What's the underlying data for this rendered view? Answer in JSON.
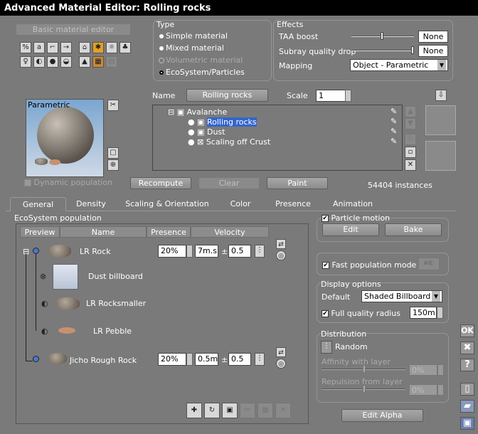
{
  "window": {
    "title": "Advanced Material Editor: Rolling rocks"
  },
  "top": {
    "basic_button": "Basic material editor",
    "type_label": "Type",
    "type_options": [
      "Simple material",
      "Mixed material",
      "Volumetric material",
      "EcoSystem/Particles"
    ],
    "effects_label": "Effects",
    "taa_label": "TAA boost",
    "taa_value": "None",
    "subray_label": "Subray quality drop",
    "subray_value": "None",
    "mapping_label": "Mapping",
    "mapping_value": "Object - Parametric",
    "preview_label": "Parametric",
    "dynamic_population": "Dynamic population",
    "name_label": "Name",
    "name_value": "Rolling rocks",
    "scale_label": "Scale",
    "scale_value": "1",
    "tree": {
      "root": "Avalanche",
      "items": [
        "Rolling rocks",
        "Dust",
        "Scaling off Crust"
      ]
    },
    "recompute": "Recompute",
    "clear": "Clear",
    "paint": "Paint",
    "instances": "54404 instances"
  },
  "tabs": [
    "General",
    "Density",
    "Scaling & Orientation",
    "Color",
    "Presence",
    "Animation"
  ],
  "ecosystem": {
    "title": "EcoSystem population",
    "columns": [
      "Preview",
      "Name",
      "Presence",
      "Velocity"
    ],
    "rows": [
      {
        "name": "LR Rock",
        "presence": "20%",
        "velocity": "7m.s",
        "variance": "0.5"
      },
      {
        "name": "Dust billboard"
      },
      {
        "name": "LR Rocksmaller"
      },
      {
        "name": "LR Pebble"
      },
      {
        "name": "Jicho Rough Rock",
        "presence": "20%",
        "velocity": "0.5m",
        "variance": "0.5"
      }
    ],
    "pm": "±"
  },
  "right": {
    "particle_motion": "Particle motion",
    "edit": "Edit",
    "bake": "Bake",
    "fast_population": "Fast population mode",
    "display_title": "Display options",
    "default_label": "Default",
    "default_value": "Shaded Billboard",
    "full_quality": "Full quality radius",
    "full_quality_value": "150m",
    "distribution_title": "Distribution",
    "random": "Random",
    "affinity": "Affinity with layer",
    "affinity_value": "0%",
    "repulsion": "Repulsion from layer",
    "repulsion_value": "0%",
    "edit_alpha": "Edit Alpha"
  },
  "side": {
    "ok": "OK",
    "close": "✖",
    "help": "?"
  }
}
